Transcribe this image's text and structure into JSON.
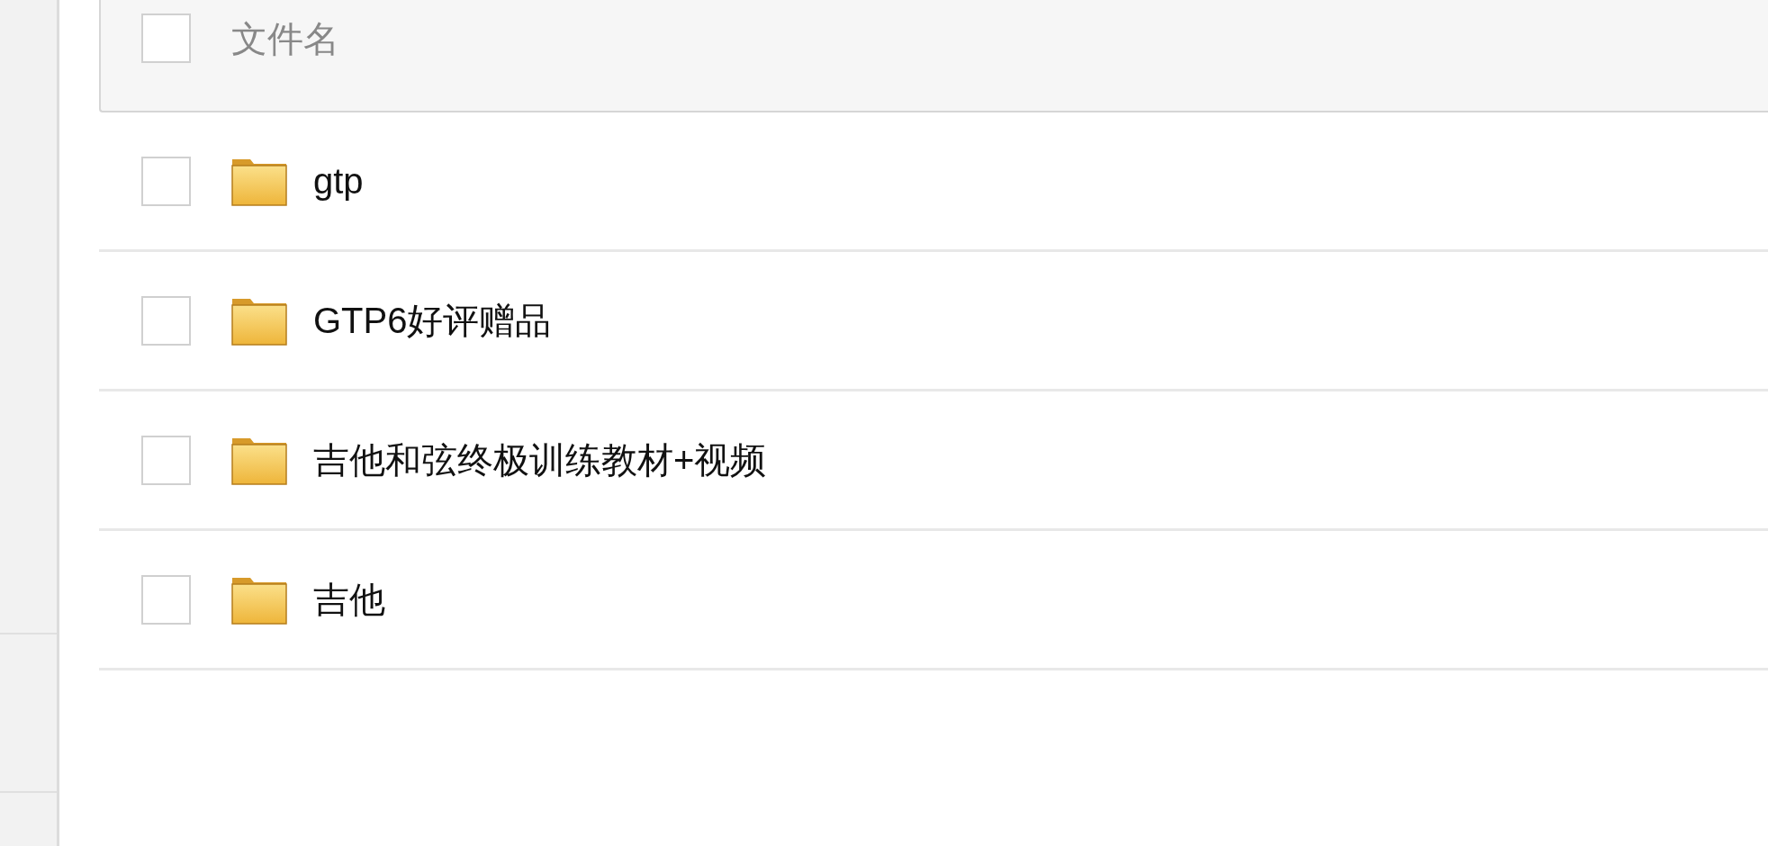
{
  "header": {
    "label": "文件名",
    "checked": false
  },
  "files": [
    {
      "name": "gtp",
      "checked": false
    },
    {
      "name": "GTP6好评赠品",
      "checked": false
    },
    {
      "name": "吉他和弦终极训练教材+视频",
      "checked": false
    },
    {
      "name": "吉他",
      "checked": false
    }
  ]
}
